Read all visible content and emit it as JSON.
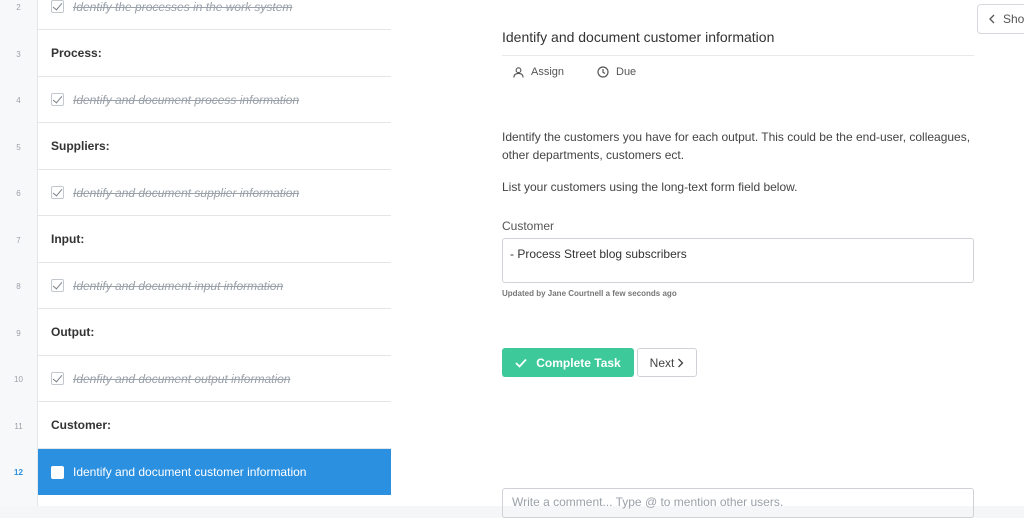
{
  "checklist": {
    "rows": [
      {
        "num": "2",
        "type": "task",
        "checked": true,
        "label": "Identify the processes in the work system"
      },
      {
        "num": "3",
        "type": "heading",
        "label": "Process:"
      },
      {
        "num": "4",
        "type": "task",
        "checked": true,
        "label": "Identify and document process information"
      },
      {
        "num": "5",
        "type": "heading",
        "label": "Suppliers:"
      },
      {
        "num": "6",
        "type": "task",
        "checked": true,
        "label": "Identify and document supplier information"
      },
      {
        "num": "7",
        "type": "heading",
        "label": "Input:"
      },
      {
        "num": "8",
        "type": "task",
        "checked": true,
        "label": "Identify and document input information"
      },
      {
        "num": "9",
        "type": "heading",
        "label": "Output:"
      },
      {
        "num": "10",
        "type": "task",
        "checked": true,
        "label": "Idenfity and document output information"
      },
      {
        "num": "11",
        "type": "heading",
        "label": "Customer:"
      },
      {
        "num": "12",
        "type": "task",
        "checked": false,
        "active": true,
        "label": "Identify and document customer information"
      }
    ]
  },
  "task": {
    "title": "Identify and document customer information",
    "assign_label": "Assign",
    "due_label": "Due",
    "description_1": "Identify the customers you have for each output. This could be the end-user, colleagues, other departments, customers ect.",
    "description_2": "List your customers using the long-text form field below.",
    "field_label": "Customer",
    "field_value": "- Process Street blog subscribers",
    "updated_text": "Updated by Jane Courtnell a few seconds ago",
    "complete_label": "Complete Task",
    "next_label": "Next",
    "comment_placeholder": "Write a comment... Type @ to mention other users."
  },
  "show_button": {
    "label": "Sho"
  },
  "colors": {
    "active_row": "#2b90e0",
    "complete_button": "#3ec99b"
  }
}
